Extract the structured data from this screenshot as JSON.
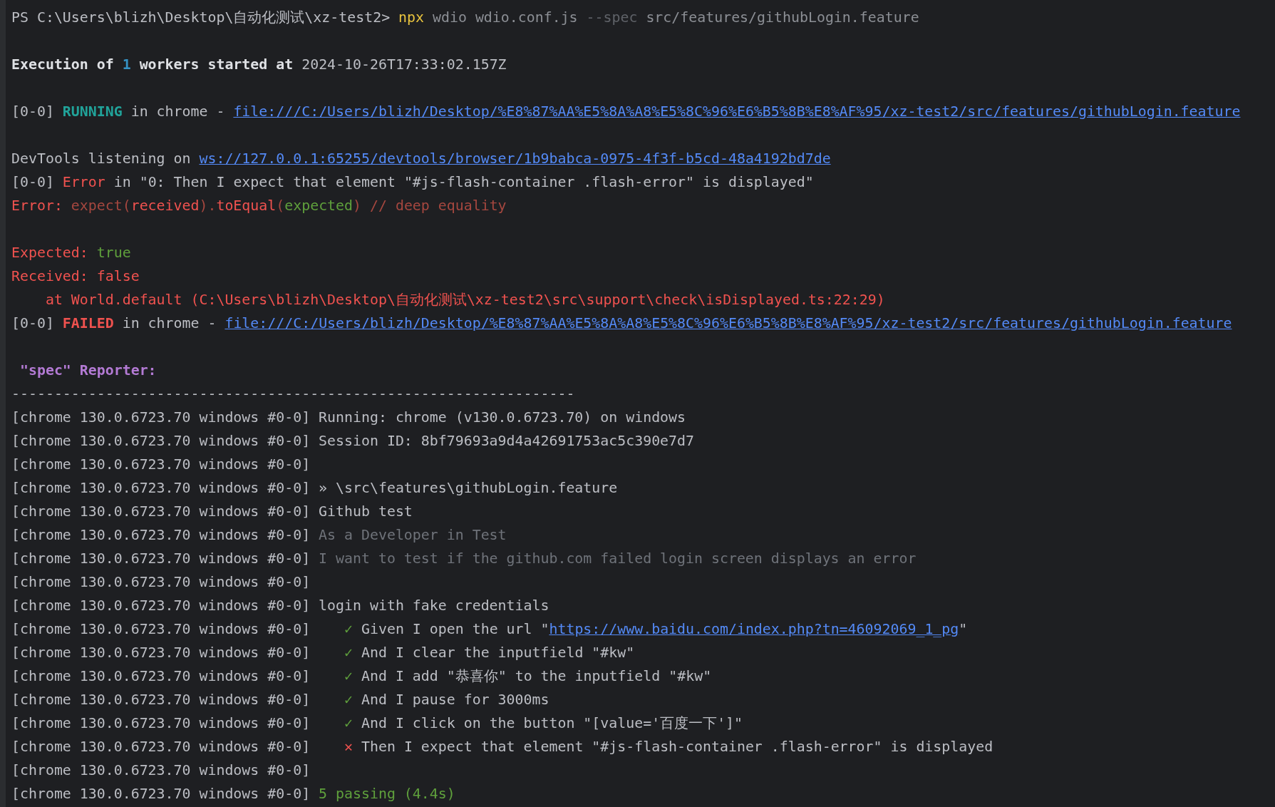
{
  "lines": [
    {
      "kind": "text",
      "segments": [
        {
          "kind": "plain",
          "text": "PS C:\\Users\\blizh\\Desktop\\自动化测试\\xz-test2> "
        },
        {
          "kind": "command",
          "text": "npx"
        },
        {
          "kind": "arg",
          "text": " wdio wdio.conf.js "
        },
        {
          "kind": "flag",
          "text": "--spec"
        },
        {
          "kind": "arg",
          "text": " src/features/githubLogin.feature"
        }
      ]
    },
    {
      "kind": "blank"
    },
    {
      "kind": "text",
      "segments": [
        {
          "kind": "bold",
          "text": "Execution of "
        },
        {
          "kind": "number",
          "text": "1"
        },
        {
          "kind": "bold",
          "text": " workers started at "
        },
        {
          "kind": "plain",
          "text": "2024-10-26T17:33:02.157Z"
        }
      ]
    },
    {
      "kind": "blank"
    },
    {
      "kind": "text",
      "segments": [
        {
          "kind": "plain",
          "text": "[0-0] "
        },
        {
          "kind": "running",
          "text": "RUNNING"
        },
        {
          "kind": "plain",
          "text": " in chrome - "
        },
        {
          "kind": "link",
          "text": "file:///C:/Users/blizh/Desktop/%E8%87%AA%E5%8A%A8%E5%8C%96%E6%B5%8B%E8%AF%95/xz-test2/src/features/githubLogin.feature"
        }
      ]
    },
    {
      "kind": "blank"
    },
    {
      "kind": "text",
      "segments": [
        {
          "kind": "plain",
          "text": "DevTools listening on "
        },
        {
          "kind": "link",
          "text": "ws://127.0.0.1:65255/devtools/browser/1b9babca-0975-4f3f-b5cd-48a4192bd7de"
        }
      ]
    },
    {
      "kind": "text",
      "segments": [
        {
          "kind": "plain",
          "text": "[0-0] "
        },
        {
          "kind": "error",
          "text": "Error"
        },
        {
          "kind": "plain",
          "text": " in \"0: Then I expect that element \"#js-flash-container .flash-error\" is displayed\""
        }
      ]
    },
    {
      "kind": "text",
      "segments": [
        {
          "kind": "error",
          "text": "Error: "
        },
        {
          "kind": "error-dim",
          "text": "expect("
        },
        {
          "kind": "error",
          "text": "received"
        },
        {
          "kind": "error-dim",
          "text": ")."
        },
        {
          "kind": "error",
          "text": "toEqual"
        },
        {
          "kind": "error-dim",
          "text": "("
        },
        {
          "kind": "success",
          "text": "expected"
        },
        {
          "kind": "error-dim",
          "text": ") // deep equality"
        }
      ]
    },
    {
      "kind": "blank"
    },
    {
      "kind": "text",
      "segments": [
        {
          "kind": "error",
          "text": "Expected: "
        },
        {
          "kind": "success",
          "text": "true"
        }
      ]
    },
    {
      "kind": "text",
      "segments": [
        {
          "kind": "error",
          "text": "Received: false"
        }
      ]
    },
    {
      "kind": "text",
      "segments": [
        {
          "kind": "error",
          "text": "    at World.default (C:\\Users\\blizh\\Desktop\\自动化测试\\xz-test2\\src\\support\\check\\isDisplayed.ts:22:29)"
        }
      ]
    },
    {
      "kind": "text",
      "segments": [
        {
          "kind": "plain",
          "text": "[0-0] "
        },
        {
          "kind": "failed",
          "text": "FAILED"
        },
        {
          "kind": "plain",
          "text": " in chrome - "
        },
        {
          "kind": "link",
          "text": "file:///C:/Users/blizh/Desktop/%E8%87%AA%E5%8A%A8%E5%8C%96%E6%B5%8B%E8%AF%95/xz-test2/src/features/githubLogin.feature"
        }
      ]
    },
    {
      "kind": "blank"
    },
    {
      "kind": "text",
      "segments": [
        {
          "kind": "heading",
          "text": " \"spec\" Reporter:"
        }
      ]
    },
    {
      "kind": "text",
      "segments": [
        {
          "kind": "plain",
          "text": "------------------------------------------------------------------"
        }
      ]
    },
    {
      "kind": "text",
      "segments": [
        {
          "kind": "plain",
          "text": "[chrome 130.0.6723.70 windows #0-0] Running: chrome (v130.0.6723.70) on windows"
        }
      ]
    },
    {
      "kind": "text",
      "segments": [
        {
          "kind": "plain",
          "text": "[chrome 130.0.6723.70 windows #0-0] Session ID: 8bf79693a9d4a42691753ac5c390e7d7"
        }
      ]
    },
    {
      "kind": "text",
      "segments": [
        {
          "kind": "plain",
          "text": "[chrome 130.0.6723.70 windows #0-0]"
        }
      ]
    },
    {
      "kind": "text",
      "segments": [
        {
          "kind": "plain",
          "text": "[chrome 130.0.6723.70 windows #0-0] » \\src\\features\\githubLogin.feature"
        }
      ]
    },
    {
      "kind": "text",
      "segments": [
        {
          "kind": "plain",
          "text": "[chrome 130.0.6723.70 windows #0-0] Github test"
        }
      ]
    },
    {
      "kind": "text",
      "segments": [
        {
          "kind": "plain",
          "text": "[chrome 130.0.6723.70 windows #0-0] "
        },
        {
          "kind": "muted",
          "text": "As a Developer in Test"
        }
      ]
    },
    {
      "kind": "text",
      "segments": [
        {
          "kind": "plain",
          "text": "[chrome 130.0.6723.70 windows #0-0] "
        },
        {
          "kind": "muted",
          "text": "I want to test if the github.com failed login screen displays an error"
        }
      ]
    },
    {
      "kind": "text",
      "segments": [
        {
          "kind": "plain",
          "text": "[chrome 130.0.6723.70 windows #0-0]"
        }
      ]
    },
    {
      "kind": "text",
      "segments": [
        {
          "kind": "plain",
          "text": "[chrome 130.0.6723.70 windows #0-0] login with fake credentials"
        }
      ]
    },
    {
      "kind": "text",
      "segments": [
        {
          "kind": "plain",
          "text": "[chrome 130.0.6723.70 windows #0-0]    "
        },
        {
          "kind": "success",
          "text": "✓"
        },
        {
          "kind": "plain",
          "text": " Given I open the url \""
        },
        {
          "kind": "link",
          "text": "https://www.baidu.com/index.php?tn=46092069_1_pg"
        },
        {
          "kind": "plain",
          "text": "\""
        }
      ]
    },
    {
      "kind": "text",
      "segments": [
        {
          "kind": "plain",
          "text": "[chrome 130.0.6723.70 windows #0-0]    "
        },
        {
          "kind": "success",
          "text": "✓"
        },
        {
          "kind": "plain",
          "text": " And I clear the inputfield \"#kw\""
        }
      ]
    },
    {
      "kind": "text",
      "segments": [
        {
          "kind": "plain",
          "text": "[chrome 130.0.6723.70 windows #0-0]    "
        },
        {
          "kind": "success",
          "text": "✓"
        },
        {
          "kind": "plain",
          "text": " And I add \"恭喜你\" to the inputfield \"#kw\""
        }
      ]
    },
    {
      "kind": "text",
      "segments": [
        {
          "kind": "plain",
          "text": "[chrome 130.0.6723.70 windows #0-0]    "
        },
        {
          "kind": "success",
          "text": "✓"
        },
        {
          "kind": "plain",
          "text": " And I pause for 3000ms"
        }
      ]
    },
    {
      "kind": "text",
      "segments": [
        {
          "kind": "plain",
          "text": "[chrome 130.0.6723.70 windows #0-0]    "
        },
        {
          "kind": "success",
          "text": "✓"
        },
        {
          "kind": "plain",
          "text": " And I click on the button \"[value='百度一下']\""
        }
      ]
    },
    {
      "kind": "text",
      "segments": [
        {
          "kind": "plain",
          "text": "[chrome 130.0.6723.70 windows #0-0]    "
        },
        {
          "kind": "failed",
          "text": "✕"
        },
        {
          "kind": "plain",
          "text": " Then I expect that element \"#js-flash-container .flash-error\" is displayed"
        }
      ]
    },
    {
      "kind": "text",
      "segments": [
        {
          "kind": "plain",
          "text": "[chrome 130.0.6723.70 windows #0-0]"
        }
      ]
    },
    {
      "kind": "text",
      "segments": [
        {
          "kind": "plain",
          "text": "[chrome 130.0.6723.70 windows #0-0] "
        },
        {
          "kind": "success",
          "text": "5 passing (4.4s)"
        }
      ]
    }
  ]
}
